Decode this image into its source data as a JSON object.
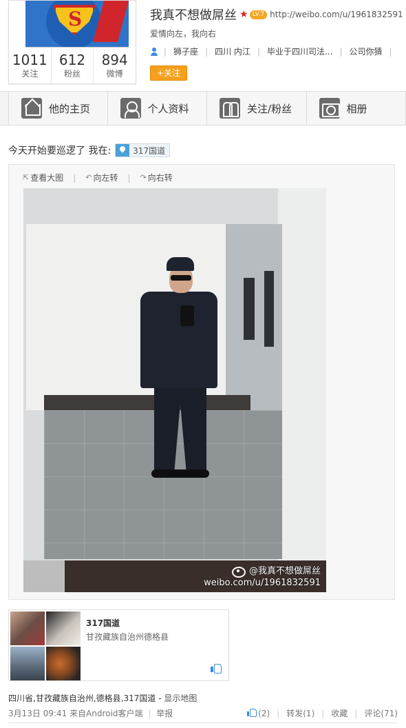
{
  "profile": {
    "name": "我真不想做屌丝",
    "level_badge": "LV.7",
    "url": "http://weibo.com/u/1961832591",
    "bio": "爱情向左，我向右",
    "tags": [
      "狮子座",
      "四川 内江",
      "毕业于四川司法...",
      "公司你猜"
    ],
    "follow_label": "+关注",
    "stats": [
      {
        "value": "1011",
        "label": "关注"
      },
      {
        "value": "612",
        "label": "粉丝"
      },
      {
        "value": "894",
        "label": "微博"
      }
    ]
  },
  "tabs": [
    {
      "label": "他的主页",
      "icon": "home-icon"
    },
    {
      "label": "个人资料",
      "icon": "profile-icon"
    },
    {
      "label": "关注/粉丝",
      "icon": "follow-fans-icon"
    },
    {
      "label": "相册",
      "icon": "camera-icon"
    }
  ],
  "post": {
    "text": "今天开始要巡逻了 我在:",
    "location_chip": "317国道",
    "toolbar": {
      "view_large": "查看大图",
      "rotate_left": "向左转",
      "rotate_right": "向右转"
    },
    "watermark": {
      "name": "@我真不想做屌丝",
      "url": "weibo.com/u/1961832591"
    },
    "location_card": {
      "name": "317国道",
      "sub": "甘孜藏族自治州德格县"
    },
    "location_line": "四川省,甘孜藏族自治州,德格县,317国道",
    "show_map": "显示地图",
    "footer": {
      "time": "3月13日 09:41",
      "source": "来自Android客户端",
      "report": "举报",
      "likes": "(2)",
      "repost": "转发(1)",
      "favorite": "收藏",
      "comment": "评论(71)"
    }
  },
  "colors": {
    "accent_orange": "#f7a01c",
    "link_blue": "#3a8de0",
    "star_red": "#e02020"
  }
}
